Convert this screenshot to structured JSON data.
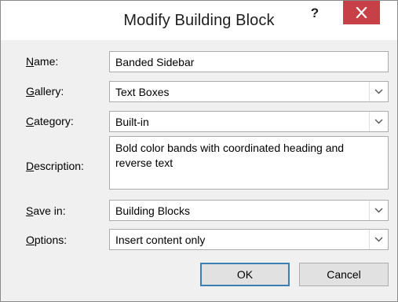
{
  "dialog": {
    "title": "Modify Building Block",
    "help_label": "?",
    "close_icon": "close-x-icon"
  },
  "fields": {
    "name": {
      "label_accel": "N",
      "label_rest": "ame:",
      "value": "Banded Sidebar"
    },
    "gallery": {
      "label_accel": "G",
      "label_rest": "allery:",
      "value": "Text Boxes"
    },
    "category": {
      "label_accel": "C",
      "label_rest": "ategory:",
      "value": "Built-in"
    },
    "description": {
      "label_accel": "D",
      "label_rest": "escription:",
      "value": "Bold color bands with coordinated heading and reverse text"
    },
    "save_in": {
      "label_accel": "S",
      "label_rest": "ave in:",
      "value": "Building Blocks"
    },
    "options": {
      "label_accel": "O",
      "label_rest": "ptions:",
      "value": "Insert content only"
    }
  },
  "buttons": {
    "ok_label": "OK",
    "cancel_label": "Cancel"
  },
  "colors": {
    "close_bg": "#c74048",
    "ok_border": "#3c7fb1",
    "dialog_bg": "#f0f0f0"
  }
}
